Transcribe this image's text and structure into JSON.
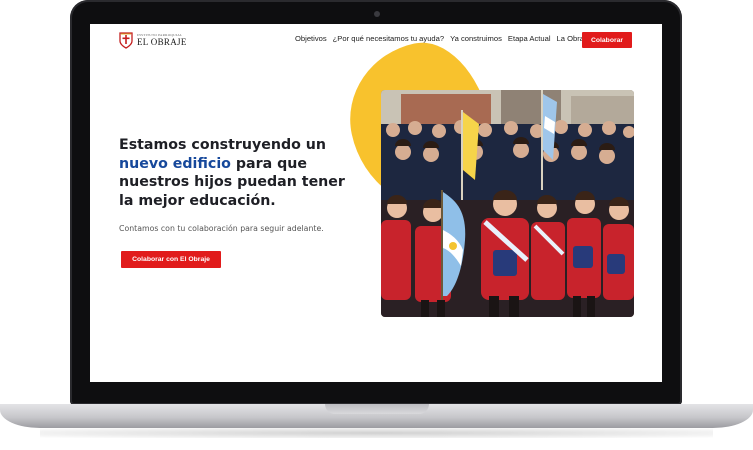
{
  "header": {
    "logo_small": "INSTITUTO PARROQUIAL",
    "logo_name": "EL OBRAJE",
    "nav": [
      "Objetivos",
      "¿Por qué necesitamos tu ayuda?",
      "Ya construimos",
      "Etapa Actual",
      "La Obra"
    ],
    "cta_label": "Colaborar"
  },
  "hero": {
    "title_before": "Estamos construyendo un ",
    "title_highlight": "nuevo edificio",
    "title_after": " para que nuestros hijos puedan tener la mejor educación.",
    "subtitle": "Contamos con tu colaboración para seguir adelante.",
    "cta_label": "Colaborar con El Obraje"
  },
  "colors": {
    "accent_red": "#e11b1b",
    "highlight_blue": "#16489b",
    "blob_yellow": "#f8c22d",
    "text_dark": "#1e1f25"
  },
  "icons": {
    "logo": "school-crest-icon",
    "camera": "camera-dot-icon"
  },
  "photo": {
    "subject": "students-with-argentine-flags"
  }
}
